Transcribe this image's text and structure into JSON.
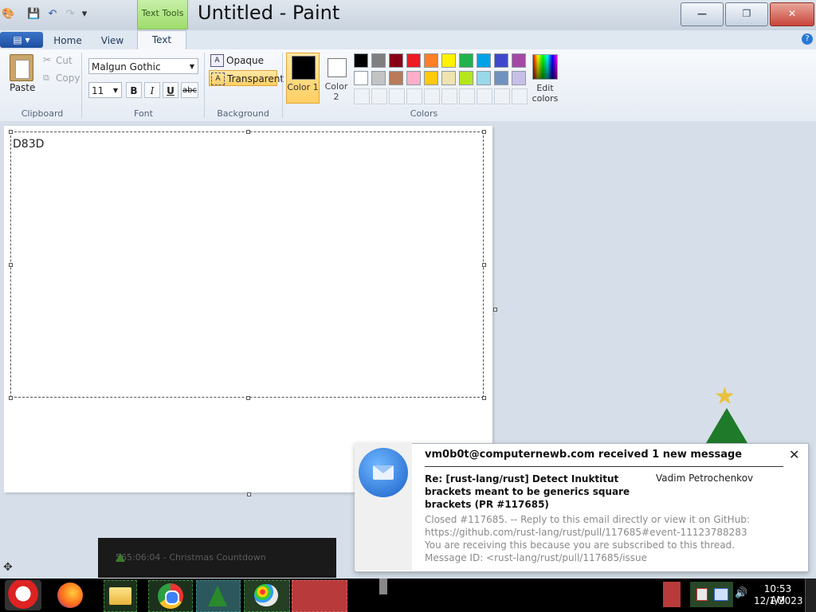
{
  "window": {
    "title": "Untitled - Paint",
    "context_tab": "Text Tools"
  },
  "tabs": [
    "Home",
    "View",
    "Text"
  ],
  "ribbon": {
    "clipboard": {
      "paste": "Paste",
      "cut": "Cut",
      "copy": "Copy",
      "group": "Clipboard"
    },
    "font": {
      "family": "Malgun Gothic",
      "size": "11",
      "bold": "B",
      "italic": "I",
      "underline": "U",
      "strike": "abc",
      "group": "Font"
    },
    "background": {
      "opaque": "Opaque",
      "transparent": "Transparent",
      "group": "Background"
    },
    "colors": {
      "color1_label": "Color 1",
      "color2_label": "Color 2",
      "edit": "Edit colors",
      "group": "Colors",
      "color1": "#000000",
      "color2": "#ffffff",
      "palette_row1": [
        "#000000",
        "#7f7f7f",
        "#880015",
        "#ed1c24",
        "#ff7f27",
        "#fff200",
        "#22b14c",
        "#00a2e8",
        "#3f48cc",
        "#a349a4"
      ],
      "palette_row2": [
        "#ffffff",
        "#c3c3c3",
        "#b97a57",
        "#ffaec9",
        "#ffc90e",
        "#efe4b0",
        "#b5e61d",
        "#99d9ea",
        "#7092be",
        "#c8bfe7"
      ]
    }
  },
  "canvas": {
    "text": "D83D"
  },
  "notification": {
    "header": "vm0b0t@computernewb.com received 1 new message",
    "subject": "Re: [rust-lang/rust] Detect Inuktitut brackets meant to be generics square brackets (PR #117685)",
    "sender": "Vadim Petrochenkov",
    "body": "Closed #117685. -- Reply to this email directly or view it on GitHub: https://github.com/rust-lang/rust/pull/117685#event-11123788283 You are receiving this because you are subscribed to this thread. Message ID: <rust-lang/rust/pull/117685/issue"
  },
  "countdown": {
    "text": "565:06:04 - Christmas Countdown"
  },
  "taskbar": {
    "time": "10:53 AM",
    "date": "12/1/2023"
  }
}
